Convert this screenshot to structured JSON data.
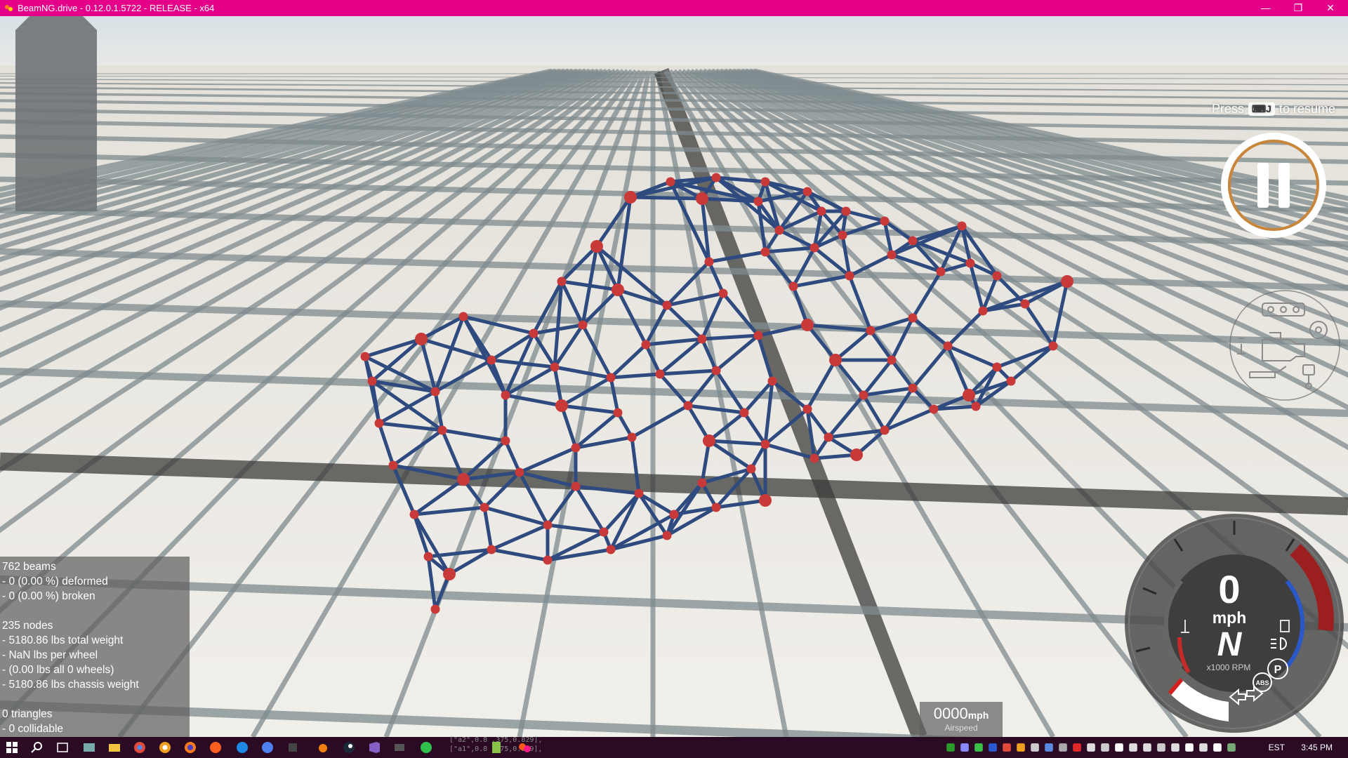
{
  "window": {
    "title": "BeamNG.drive - 0.12.0.1.5722 - RELEASE - x64",
    "minimize_label": "—",
    "restore_label": "❐",
    "close_label": "✕",
    "accent_color": "#e5008a"
  },
  "scene": {
    "sky_color": "#dce4e8",
    "floor_color": "#ebe8e2",
    "mesh_beam_color": "#2e4a7e",
    "mesh_node_color": "#c83a3a"
  },
  "debug_stats": {
    "lines": [
      "762 beams",
      "- 0 (0.00 %) deformed",
      "- 0 (0.00 %) broken",
      "",
      "235 nodes",
      "- 5180.86 lbs total weight",
      "- NaN lbs per wheel",
      "- (0.00 lbs all 0 wheels)",
      "- 5180.86 lbs chassis weight",
      "",
      "0 triangles",
      "- 0 collidable"
    ]
  },
  "resume_hint": {
    "prefix": "Press",
    "key_label": "⌨J",
    "suffix": "to resume"
  },
  "gauge": {
    "speed": "0",
    "unit": "mph",
    "gear": "N",
    "rpm_label": "x1000 RPM",
    "p_badge": "P",
    "abs_badge": "ABS"
  },
  "airspeed": {
    "value": "0000",
    "unit": "mph",
    "label": "Airspeed"
  },
  "taskbar": {
    "language": "EST",
    "time": "3:45 PM",
    "console_lines": [
      "[\"a2\",0.8 .375,0.829],",
      "[\"a1\",0.8 .375,0.829],"
    ]
  }
}
